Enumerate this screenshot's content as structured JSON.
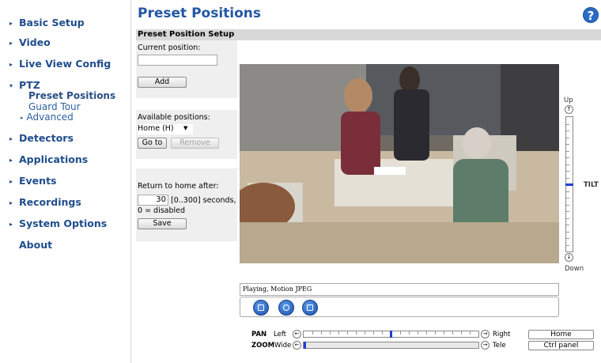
{
  "sidebar": {
    "items": [
      {
        "label": "Basic Setup"
      },
      {
        "label": "Video"
      },
      {
        "label": "Live View Config"
      },
      {
        "label": "PTZ"
      },
      {
        "label": "Detectors"
      },
      {
        "label": "Applications"
      },
      {
        "label": "Events"
      },
      {
        "label": "Recordings"
      },
      {
        "label": "System Options"
      },
      {
        "label": "About"
      }
    ],
    "ptz_sub": {
      "preset_positions": "Preset Positions",
      "guard_tour": "Guard Tour",
      "advanced": "Advanced"
    }
  },
  "header": {
    "title": "Preset Positions",
    "help": "?"
  },
  "section": {
    "title": "Preset Position Setup"
  },
  "setup": {
    "current_position_label": "Current position:",
    "current_position_value": "",
    "add_label": "Add",
    "available_label": "Available positions:",
    "available_selected": "Home (H)",
    "goto_label": "Go to",
    "remove_label": "Remove",
    "return_label": "Return to home after:",
    "return_value": "30",
    "return_hint": "[0..300] seconds,",
    "return_disabled_hint": "0 = disabled",
    "save_label": "Save"
  },
  "tilt": {
    "up_label": "Up",
    "down_label": "Down",
    "tilt_label": "TILT",
    "level": 0.5
  },
  "player": {
    "status": "Playing, Motion JPEG"
  },
  "pan": {
    "label": "PAN",
    "left_label": "Left",
    "right_label": "Right",
    "level": 0.5
  },
  "zoom": {
    "label": "ZOOM",
    "wide_label": "Wide",
    "tele_label": "Tele",
    "level": 0.0
  },
  "buttons": {
    "home": "Home",
    "ctrl_panel": "Ctrl panel"
  },
  "colors": {
    "nav": "#1f4d8c",
    "title": "#2457a4",
    "accent": "#1a4fae"
  }
}
